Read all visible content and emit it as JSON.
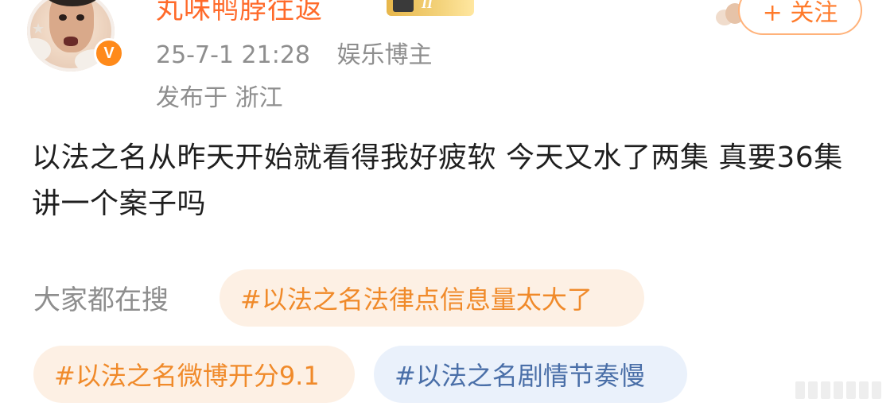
{
  "post": {
    "username": "丸味鸭脖往返",
    "level_badge_num": "II",
    "timestamp": "25-7-1 21:28",
    "category": "娱乐博主",
    "location": "发布于 浙江",
    "body": "以法之名从昨天开始就看得我好疲软 今天又水了两集 真要36集讲一个案子吗",
    "follow_label": "+ 关注"
  },
  "hot_search": {
    "title": "大家都在搜",
    "chips": [
      {
        "label": "#以法之名法律点信息量太大了",
        "color": "orange"
      },
      {
        "label": "#以法之名微博开分9.1",
        "color": "orange"
      },
      {
        "label": "#以法之名剧情节奏慢",
        "color": "blue"
      }
    ]
  },
  "colors": {
    "username": "#ff6a2a",
    "orange_chip_bg": "#fdf0e4",
    "orange_chip_text": "#f08a2a",
    "blue_chip_bg": "#eaf1fb",
    "blue_chip_text": "#4a6fa8",
    "meta_gray": "#8e8e8e"
  },
  "icons": {
    "verified": "verified-v-badge-icon",
    "level": "crown-level-icon"
  }
}
